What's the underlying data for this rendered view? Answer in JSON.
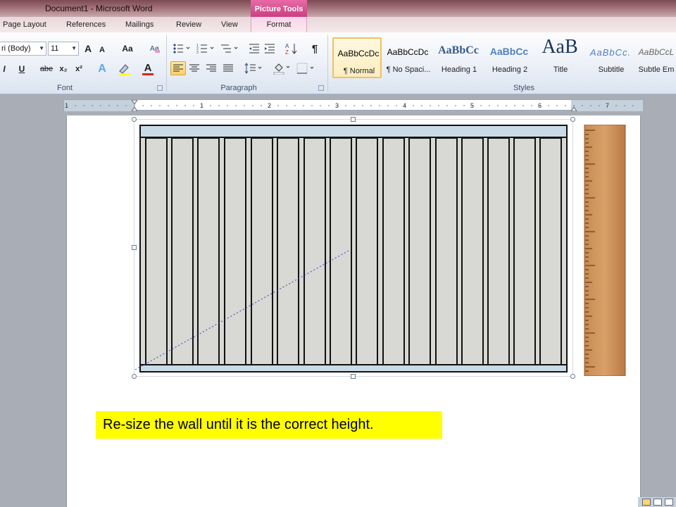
{
  "window": {
    "title": "Document1  -  Microsoft Word",
    "contextual_tab_group": "Picture Tools"
  },
  "tabs": [
    {
      "label": "Page Layout"
    },
    {
      "label": "References"
    },
    {
      "label": "Mailings"
    },
    {
      "label": "Review"
    },
    {
      "label": "View"
    },
    {
      "label": "Format"
    }
  ],
  "ribbon": {
    "font": {
      "group_label": "Font",
      "font_name": "ri (Body)",
      "font_size": "11",
      "grow_label": "A",
      "shrink_label": "A",
      "case_label": "Aa",
      "italic_label": "I",
      "underline_label": "U",
      "strike_label": "abe",
      "subscript_label": "x₂",
      "superscript_label": "x²",
      "text_effects_label": "A",
      "font_color_label": "A"
    },
    "paragraph": {
      "group_label": "Paragraph",
      "pilcrow_label": "¶"
    },
    "styles": {
      "group_label": "Styles",
      "items": [
        {
          "sample": "AaBbCcDc",
          "name": "¶ Normal"
        },
        {
          "sample": "AaBbCcDc",
          "name": "¶ No Spaci..."
        },
        {
          "sample": "AaBbCc",
          "name": "Heading 1"
        },
        {
          "sample": "AaBbCc",
          "name": "Heading 2"
        },
        {
          "sample": "AaB",
          "name": "Title"
        },
        {
          "sample": "AaBbCc.",
          "name": "Subtitle"
        },
        {
          "sample": "AaBbCcL",
          "name": "Subtle Em"
        }
      ]
    }
  },
  "ruler": {
    "labels": [
      "1",
      "1",
      "2",
      "3",
      "4",
      "5",
      "6",
      "7"
    ]
  },
  "document": {
    "instruction": "Re-size the wall until it is the correct height."
  },
  "colors": {
    "picture_tools": "#d84f90",
    "highlight": "#ffff00",
    "wall_fill": "#d8d8d4",
    "wall_rail": "#c9dbe6"
  },
  "icons": {
    "bold": "bold-icon",
    "paste_format": "format-painter-icon"
  }
}
